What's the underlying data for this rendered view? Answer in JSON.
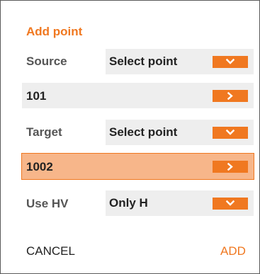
{
  "dialog": {
    "title": "Add point",
    "source": {
      "label": "Source",
      "select_value": "Select point",
      "point_value": "101"
    },
    "target": {
      "label": "Target",
      "select_value": "Select point",
      "point_value": "1002"
    },
    "use_hv": {
      "label": "Use HV",
      "select_value": "Only H"
    },
    "actions": {
      "cancel_label": "CANCEL",
      "add_label": "ADD"
    }
  },
  "colors": {
    "accent": "#f07820",
    "selected_field": "#f7b68a",
    "field_bg": "#eeeeee",
    "label_text": "#555555"
  },
  "icons": {
    "dropdown": "chevron-down-icon",
    "navigate": "chevron-right-icon"
  }
}
